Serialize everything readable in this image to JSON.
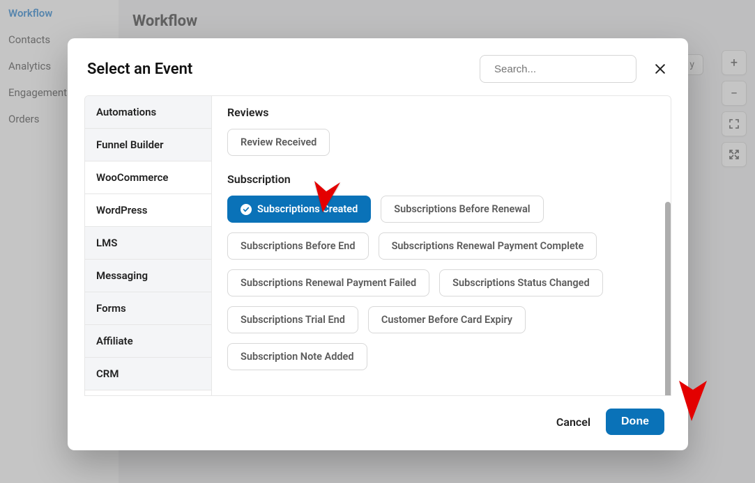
{
  "bg_nav": {
    "items": [
      "Workflow",
      "Contacts",
      "Analytics",
      "Engagements",
      "Orders"
    ],
    "active_index": 0
  },
  "bg_header": "Workflow",
  "bg_chip_partial": "y",
  "tools": {
    "zoom_in": "+",
    "zoom_out": "−",
    "fit": "⛶",
    "fullscreen": "⤢"
  },
  "modal": {
    "title": "Select an Event",
    "search_placeholder": "Search...",
    "categories": [
      "Automations",
      "Funnel Builder",
      "WooCommerce",
      "WordPress",
      "LMS",
      "Messaging",
      "Forms",
      "Affiliate",
      "CRM"
    ],
    "active_category_index": 2,
    "section_reviews": "Reviews",
    "reviews_events": [
      "Review Received"
    ],
    "section_subscription": "Subscription",
    "subscription_events": [
      "Subscriptions Created",
      "Subscriptions Before Renewal",
      "Subscriptions Before End",
      "Subscriptions Renewal Payment Complete",
      "Subscriptions Renewal Payment Failed",
      "Subscriptions Status Changed",
      "Subscriptions Trial End",
      "Customer Before Card Expiry",
      "Subscription Note Added"
    ],
    "selected_event_index": 0,
    "cancel": "Cancel",
    "done": "Done"
  }
}
